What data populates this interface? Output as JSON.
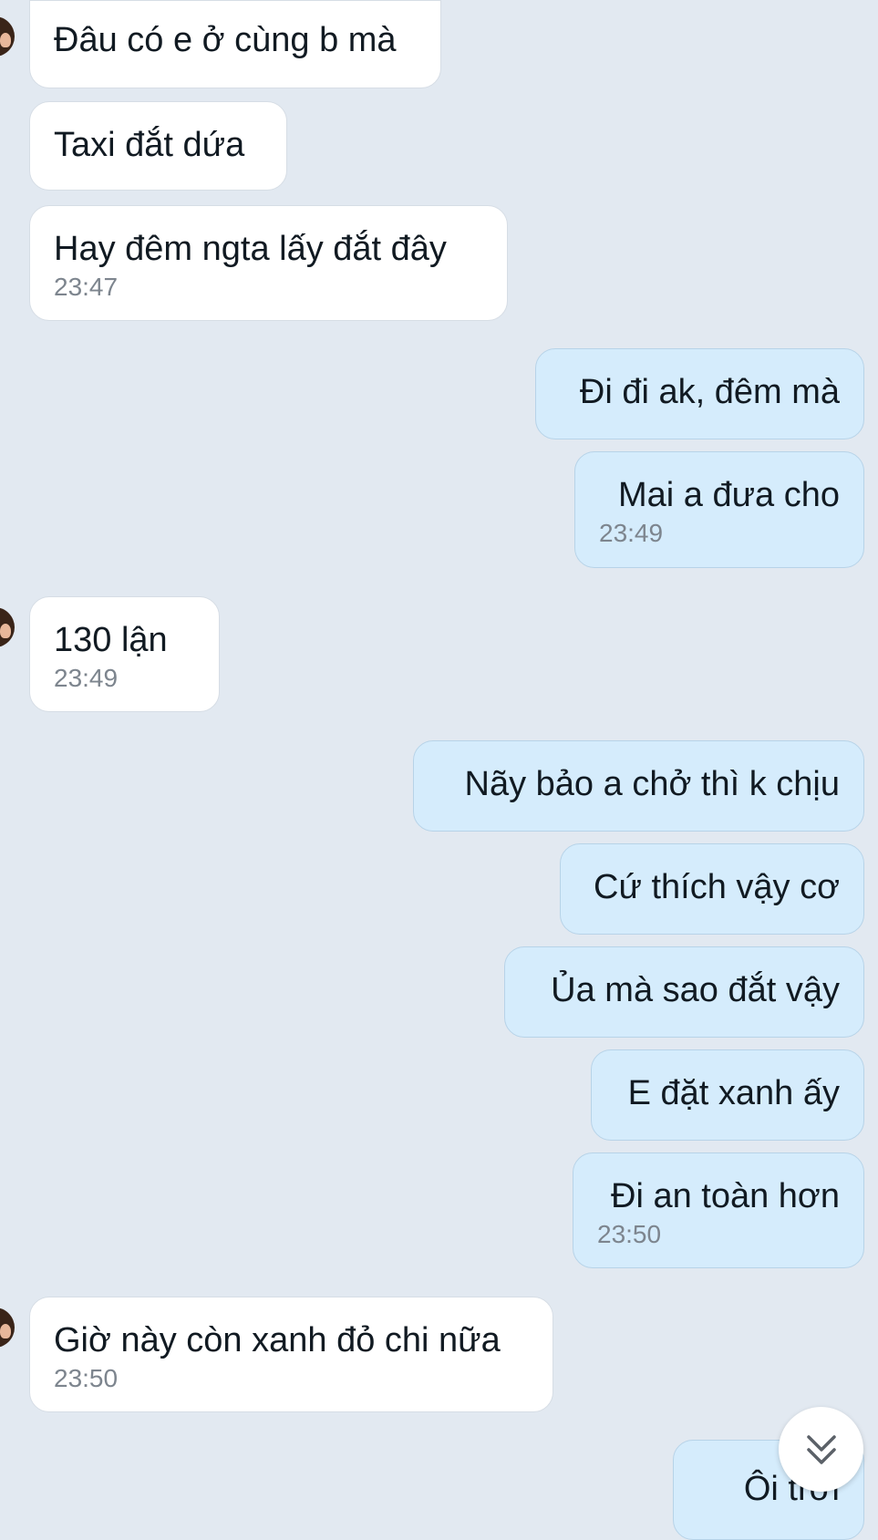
{
  "messages": [
    {
      "direction": "in",
      "text": "Đâu có e ở cùng b mà",
      "time": null,
      "avatar": true
    },
    {
      "direction": "in",
      "text": "Taxi đắt dứa",
      "time": null,
      "avatar": false
    },
    {
      "direction": "in",
      "text": "Hay đêm ngta lấy đắt đây",
      "time": "23:47",
      "avatar": false
    },
    {
      "direction": "out",
      "text": "Đi đi ak, đêm mà",
      "time": null
    },
    {
      "direction": "out",
      "text": "Mai a đưa cho",
      "time": "23:49"
    },
    {
      "direction": "in",
      "text": "130 lận",
      "time": "23:49",
      "avatar": true
    },
    {
      "direction": "out",
      "text": "Nãy bảo a chở thì k chịu",
      "time": null
    },
    {
      "direction": "out",
      "text": "Cứ thích vậy cơ",
      "time": null
    },
    {
      "direction": "out",
      "text": "Ủa mà sao đắt vậy",
      "time": null
    },
    {
      "direction": "out",
      "text": "E đặt xanh ấy",
      "time": null
    },
    {
      "direction": "out",
      "text": "Đi an toàn hơn",
      "time": "23:50"
    },
    {
      "direction": "in",
      "text": "Giờ này còn xanh đỏ chi nữa",
      "time": "23:50",
      "avatar": true
    },
    {
      "direction": "out",
      "text": "Ôi trời",
      "time": null
    }
  ],
  "scroll_button": {
    "icon": "double-chevron-down-icon"
  },
  "colors": {
    "background": "#e2e9f1",
    "incoming_bubble": "#ffffff",
    "outgoing_bubble": "#d5ecfc",
    "time_text": "#7d858e"
  }
}
